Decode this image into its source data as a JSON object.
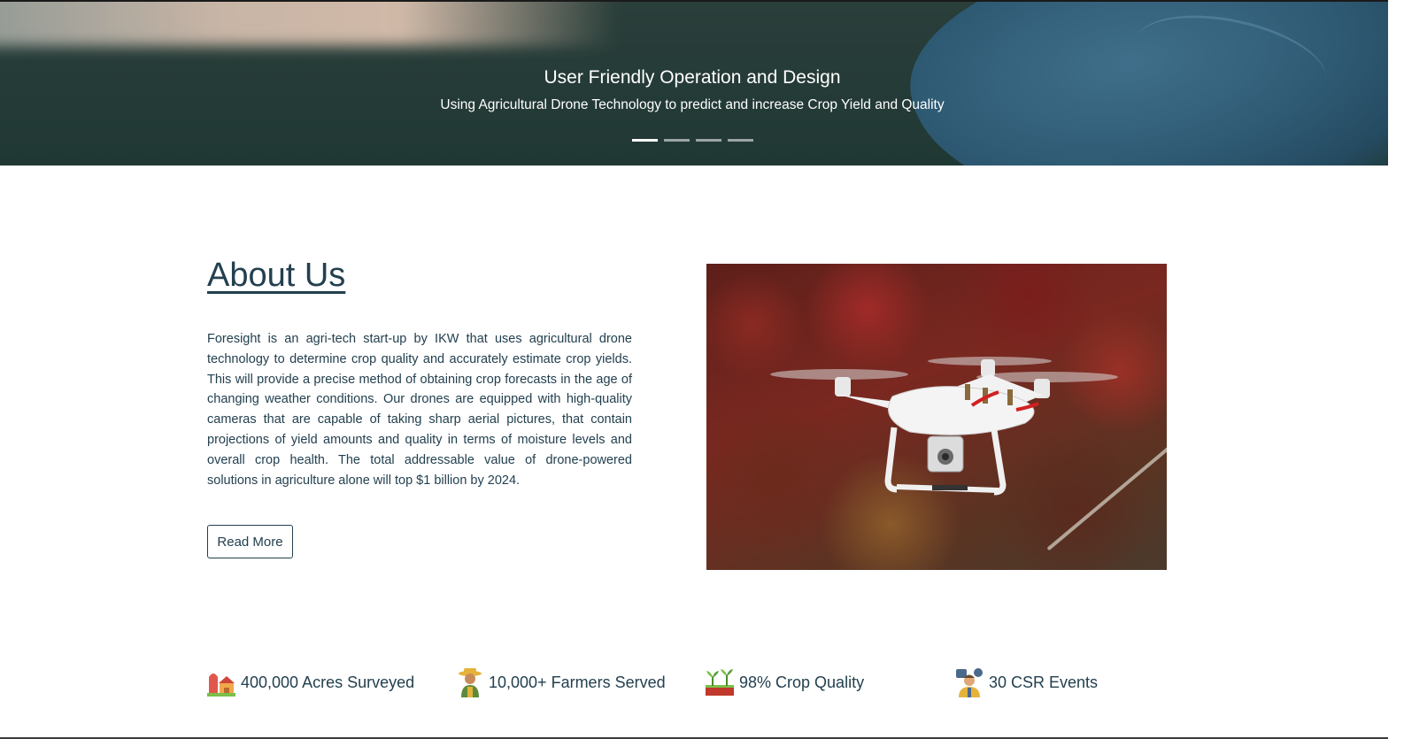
{
  "hero": {
    "title": "User Friendly Operation and Design",
    "subtitle": "Using Agricultural Drone Technology to predict and increase Crop Yield and Quality",
    "slides": 4,
    "active_slide": 1
  },
  "about": {
    "heading": "About Us",
    "body": "Foresight is an agri-tech start-up by IKW that uses agricultural drone technology to determine crop quality and accurately estimate crop yields. This will provide a precise method of obtaining crop forecasts in the age of changing weather conditions. Our drones are equipped with high-quality cameras that are capable of taking sharp aerial pictures, that contain projections of yield amounts and quality in terms of moisture levels and overall crop health. The total addressable value of drone-powered solutions in agriculture alone will top $1 billion by 2024.",
    "read_more_label": "Read More",
    "image_icon": "drone-photo"
  },
  "stats": [
    {
      "icon": "farm-icon",
      "label": "400,000 Acres Surveyed"
    },
    {
      "icon": "farmer-icon",
      "label": "10,000+ Farmers Served"
    },
    {
      "icon": "sprout-icon",
      "label": "98% Crop Quality"
    },
    {
      "icon": "csr-event-icon",
      "label": "30 CSR Events"
    }
  ],
  "colors": {
    "text": "#23404f",
    "hero_bg": "#203834",
    "accent_red": "#c0392b"
  }
}
